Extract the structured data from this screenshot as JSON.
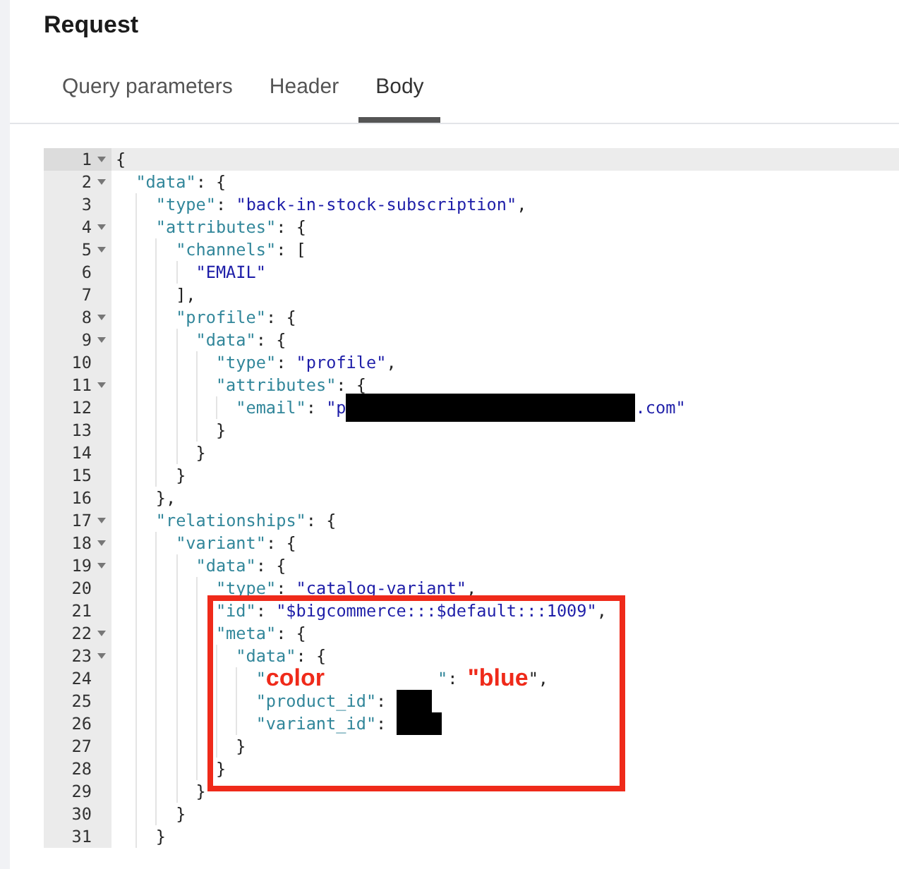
{
  "title": "Request",
  "tabs": [
    {
      "label": "Query parameters",
      "selected": false
    },
    {
      "label": "Header",
      "selected": false
    },
    {
      "label": "Body",
      "selected": true
    }
  ],
  "editor": {
    "lines": [
      {
        "number": "1",
        "fold": true,
        "active": true,
        "tokens": [
          {
            "kind": "punct",
            "text": "{"
          }
        ],
        "children": [
          {
            "number": "2",
            "fold": true,
            "active": false,
            "tokens": [
              {
                "kind": "key",
                "text": "\"data\""
              },
              {
                "kind": "punct",
                "text": ": {"
              }
            ],
            "children": [
              {
                "number": "3",
                "fold": false,
                "active": false,
                "tokens": [
                  {
                    "kind": "key",
                    "text": "\"type\""
                  },
                  {
                    "kind": "punct",
                    "text": ": "
                  },
                  {
                    "kind": "string",
                    "text": "\"back-in-stock-subscription\""
                  },
                  {
                    "kind": "punct",
                    "text": ","
                  }
                ]
              },
              {
                "number": "4",
                "fold": true,
                "active": false,
                "tokens": [
                  {
                    "kind": "key",
                    "text": "\"attributes\""
                  },
                  {
                    "kind": "punct",
                    "text": ": {"
                  }
                ],
                "children": [
                  {
                    "number": "5",
                    "fold": true,
                    "active": false,
                    "tokens": [
                      {
                        "kind": "key",
                        "text": "\"channels\""
                      },
                      {
                        "kind": "punct",
                        "text": ": ["
                      }
                    ],
                    "children": [
                      {
                        "number": "6",
                        "fold": false,
                        "active": false,
                        "tokens": [
                          {
                            "kind": "string",
                            "text": "\"EMAIL\""
                          }
                        ]
                      }
                    ]
                  },
                  {
                    "number": "7",
                    "fold": false,
                    "active": false,
                    "tokens": [
                      {
                        "kind": "punct",
                        "text": "],"
                      }
                    ]
                  },
                  {
                    "number": "8",
                    "fold": true,
                    "active": false,
                    "tokens": [
                      {
                        "kind": "key",
                        "text": "\"profile\""
                      },
                      {
                        "kind": "punct",
                        "text": ": {"
                      }
                    ],
                    "children": [
                      {
                        "number": "9",
                        "fold": true,
                        "active": false,
                        "tokens": [
                          {
                            "kind": "key",
                            "text": "\"data\""
                          },
                          {
                            "kind": "punct",
                            "text": ": {"
                          }
                        ],
                        "children": [
                          {
                            "number": "10",
                            "fold": false,
                            "active": false,
                            "tokens": [
                              {
                                "kind": "key",
                                "text": "\"type\""
                              },
                              {
                                "kind": "punct",
                                "text": ": "
                              },
                              {
                                "kind": "string",
                                "text": "\"profile\""
                              },
                              {
                                "kind": "punct",
                                "text": ","
                              }
                            ]
                          },
                          {
                            "number": "11",
                            "fold": true,
                            "active": false,
                            "tokens": [
                              {
                                "kind": "key",
                                "text": "\"attributes\""
                              },
                              {
                                "kind": "punct",
                                "text": ": {"
                              }
                            ],
                            "children": [
                              {
                                "number": "12",
                                "fold": false,
                                "active": false,
                                "tokens": [
                                  {
                                    "kind": "key",
                                    "text": "\"email\""
                                  },
                                  {
                                    "kind": "punct",
                                    "text": ": "
                                  },
                                  {
                                    "kind": "string",
                                    "text": "\"p"
                                  },
                                  {
                                    "kind": "mask"
                                  },
                                  {
                                    "kind": "string",
                                    "text": ".com\""
                                  }
                                ]
                              }
                            ]
                          },
                          {
                            "number": "13",
                            "fold": false,
                            "active": false,
                            "tokens": [
                              {
                                "kind": "punct",
                                "text": "}"
                              }
                            ]
                          }
                        ]
                      },
                      {
                        "number": "14",
                        "fold": false,
                        "active": false,
                        "tokens": [
                          {
                            "kind": "punct",
                            "text": "}"
                          }
                        ]
                      }
                    ]
                  },
                  {
                    "number": "15",
                    "fold": false,
                    "active": false,
                    "tokens": [
                      {
                        "kind": "punct",
                        "text": "}"
                      }
                    ]
                  }
                ]
              },
              {
                "number": "16",
                "fold": false,
                "active": false,
                "tokens": [
                  {
                    "kind": "punct",
                    "text": "},"
                  }
                ]
              },
              {
                "number": "17",
                "fold": true,
                "active": false,
                "tokens": [
                  {
                    "kind": "key",
                    "text": "\"relationships\""
                  },
                  {
                    "kind": "punct",
                    "text": ": {"
                  }
                ],
                "children": [
                  {
                    "number": "18",
                    "fold": true,
                    "active": false,
                    "tokens": [
                      {
                        "kind": "key",
                        "text": "\"variant\""
                      },
                      {
                        "kind": "punct",
                        "text": ": {"
                      }
                    ],
                    "children": [
                      {
                        "number": "19",
                        "fold": true,
                        "active": false,
                        "tokens": [
                          {
                            "kind": "key",
                            "text": "\"data\""
                          },
                          {
                            "kind": "punct",
                            "text": ": {"
                          }
                        ],
                        "children": [
                          {
                            "number": "20",
                            "fold": false,
                            "active": false,
                            "tokens": [
                              {
                                "kind": "key",
                                "text": "\"type\""
                              },
                              {
                                "kind": "punct",
                                "text": ": "
                              },
                              {
                                "kind": "string",
                                "text": "\"catalog-variant\""
                              },
                              {
                                "kind": "punct",
                                "text": ","
                              }
                            ]
                          },
                          {
                            "number": "21",
                            "fold": false,
                            "active": false,
                            "highlight_start": true,
                            "tokens": [
                              {
                                "kind": "key",
                                "text": "\"id\""
                              },
                              {
                                "kind": "punct",
                                "text": ": "
                              },
                              {
                                "kind": "string",
                                "text": "\"$bigcommerce:::$default:::1009\""
                              },
                              {
                                "kind": "punct",
                                "text": ","
                              }
                            ]
                          },
                          {
                            "number": "22",
                            "fold": true,
                            "active": false,
                            "tokens": [
                              {
                                "kind": "key",
                                "text": "\"meta\""
                              },
                              {
                                "kind": "punct",
                                "text": ": {"
                              }
                            ],
                            "children": [
                              {
                                "number": "23",
                                "fold": true,
                                "active": false,
                                "tokens": [
                                  {
                                    "kind": "key",
                                    "text": "\"data\""
                                  },
                                  {
                                    "kind": "punct",
                                    "text": ": {"
                                  }
                                ],
                                "children": [
                                  {
                                    "number": "24",
                                    "fold": false,
                                    "active": false,
                                    "tokens": [
                                      {
                                        "kind": "key",
                                        "text": "\""
                                      },
                                      {
                                        "kind": "note",
                                        "text": "color"
                                      },
                                      {
                                        "kind": "erased"
                                      },
                                      {
                                        "kind": "key",
                                        "text": "\""
                                      },
                                      {
                                        "kind": "punct",
                                        "text": ": "
                                      },
                                      {
                                        "kind": "note",
                                        "text": "\"blue"
                                      },
                                      {
                                        "kind": "punct",
                                        "text": "\","
                                      }
                                    ]
                                  },
                                  {
                                    "number": "25",
                                    "fold": false,
                                    "active": false,
                                    "tokens": [
                                      {
                                        "kind": "key",
                                        "text": "\"product_id\""
                                      },
                                      {
                                        "kind": "punct",
                                        "text": ": "
                                      },
                                      {
                                        "kind": "stub"
                                      }
                                    ]
                                  },
                                  {
                                    "number": "26",
                                    "fold": false,
                                    "active": false,
                                    "tokens": [
                                      {
                                        "kind": "key",
                                        "text": "\"variant_id\""
                                      },
                                      {
                                        "kind": "punct",
                                        "text": ": "
                                      },
                                      {
                                        "kind": "patch"
                                      }
                                    ]
                                  }
                                ]
                              },
                              {
                                "number": "27",
                                "fold": false,
                                "active": false,
                                "tokens": [
                                  {
                                    "kind": "punct",
                                    "text": "}"
                                  }
                                ]
                              }
                            ]
                          },
                          {
                            "number": "28",
                            "fold": false,
                            "active": false,
                            "tokens": [
                              {
                                "kind": "punct",
                                "text": "}"
                              }
                            ]
                          }
                        ]
                      },
                      {
                        "number": "29",
                        "fold": false,
                        "active": false,
                        "tokens": [
                          {
                            "kind": "punct",
                            "text": "}"
                          }
                        ]
                      }
                    ]
                  },
                  {
                    "number": "30",
                    "fold": false,
                    "active": false,
                    "tokens": [
                      {
                        "kind": "punct",
                        "text": "}"
                      }
                    ]
                  }
                ]
              },
              {
                "number": "31",
                "fold": false,
                "active": false,
                "tokens": [
                  {
                    "kind": "punct",
                    "text": "}"
                  }
                ]
              }
            ]
          }
        ]
      }
    ]
  }
}
